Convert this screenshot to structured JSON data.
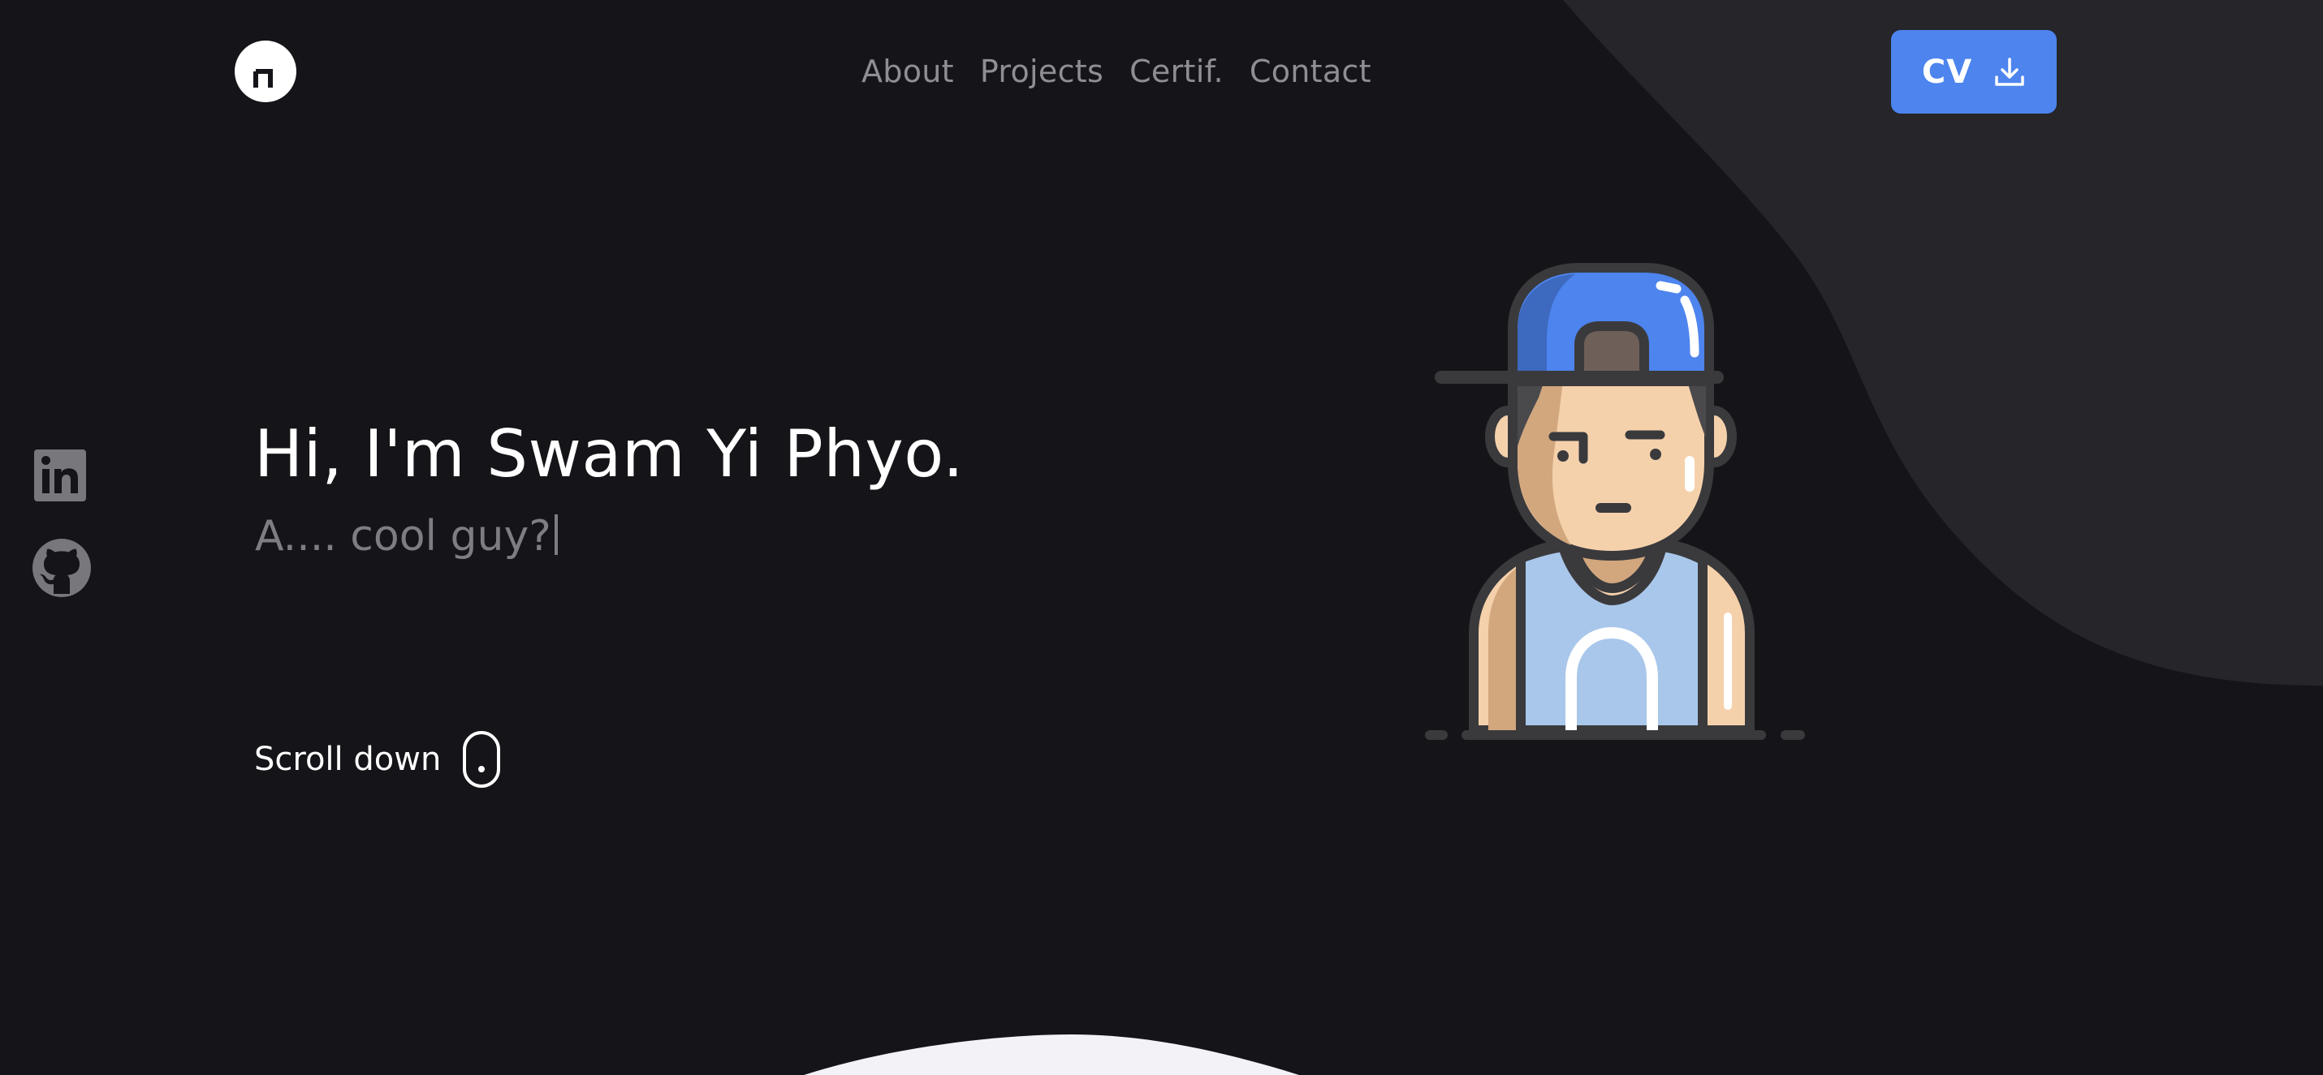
{
  "header": {
    "logo_icon": "circle-logo-icon",
    "nav": [
      {
        "label": "About"
      },
      {
        "label": "Projects"
      },
      {
        "label": "Certif."
      },
      {
        "label": "Contact"
      }
    ],
    "cv_button": {
      "label": "CV",
      "icon": "download-icon"
    }
  },
  "social": [
    {
      "icon": "linkedin-icon"
    },
    {
      "icon": "github-icon"
    }
  ],
  "hero": {
    "title": "Hi, I'm Swam Yi Phyo.",
    "subtitle": "A.... cool guy?",
    "scroll_label": "Scroll down",
    "scroll_icon": "mouse-icon",
    "avatar_icon": "avatar-boy-cap-icon"
  },
  "colors": {
    "background": "#151519",
    "wave": "#25252a",
    "accent": "#4d84ee",
    "nav_text": "#8e8e93",
    "subtitle_text": "#7d7d82"
  }
}
